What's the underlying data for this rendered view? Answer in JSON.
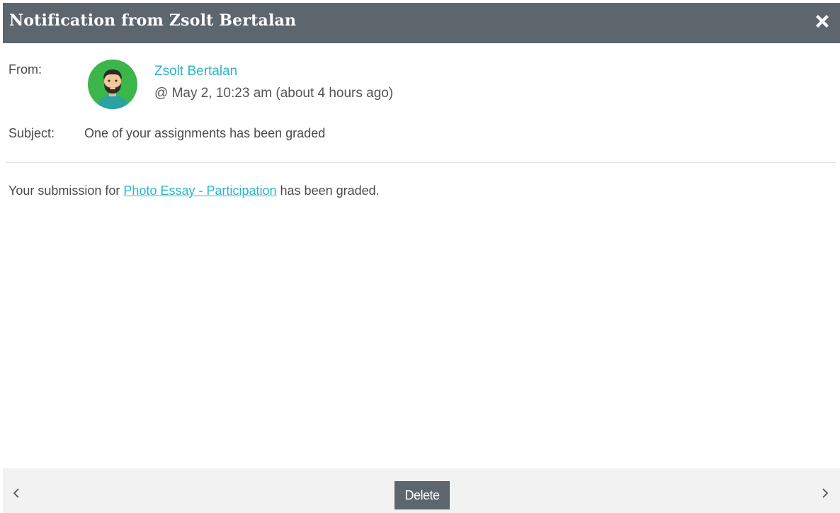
{
  "dialog": {
    "title": "Notification from Zsolt Bertalan",
    "close_icon": "close-x-icon"
  },
  "message": {
    "from_label": "From:",
    "sender_name": "Zsolt Bertalan",
    "timestamp": "@ May 2, 10:23 am (about 4 hours ago)",
    "subject_label": "Subject:",
    "subject": "One of your assignments has been graded",
    "body_prefix": "Your submission for ",
    "body_link": "Photo Essay - Participation",
    "body_suffix": " has been graded."
  },
  "footer": {
    "prev_icon": "chevron-left-icon",
    "next_icon": "chevron-right-icon",
    "delete_label": "Delete"
  },
  "colors": {
    "titlebar": "#5d656d",
    "link": "#29b6c6",
    "avatar_bg": "#3cb54a",
    "footer_bg": "#f2f2f2"
  }
}
